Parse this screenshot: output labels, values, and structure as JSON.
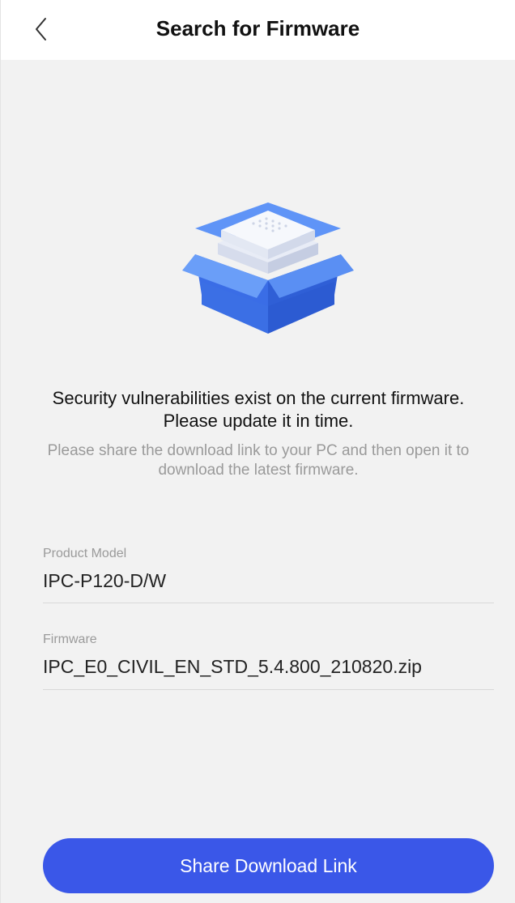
{
  "header": {
    "title": "Search for Firmware",
    "back_icon": "chevron-left-icon"
  },
  "illustration": {
    "icon": "firmware-box-icon",
    "colors": {
      "box": "#4a7ff0",
      "box_dark": "#2f5fd6",
      "device": "#f4f6fb"
    }
  },
  "message": {
    "headline": "Security vulnerabilities exist on the current firmware. Please update it in time.",
    "subtext": "Please share the download link to your PC and then open it to download the latest firmware."
  },
  "fields": {
    "product_model": {
      "label": "Product Model",
      "value": "IPC-P120-D/W"
    },
    "firmware": {
      "label": "Firmware",
      "value": "IPC_E0_CIVIL_EN_STD_5.4.800_210820.zip"
    }
  },
  "actions": {
    "share_label": "Share Download Link"
  },
  "colors": {
    "accent": "#3a57e8",
    "background": "#f2f2f2",
    "header_bg": "#ffffff"
  }
}
